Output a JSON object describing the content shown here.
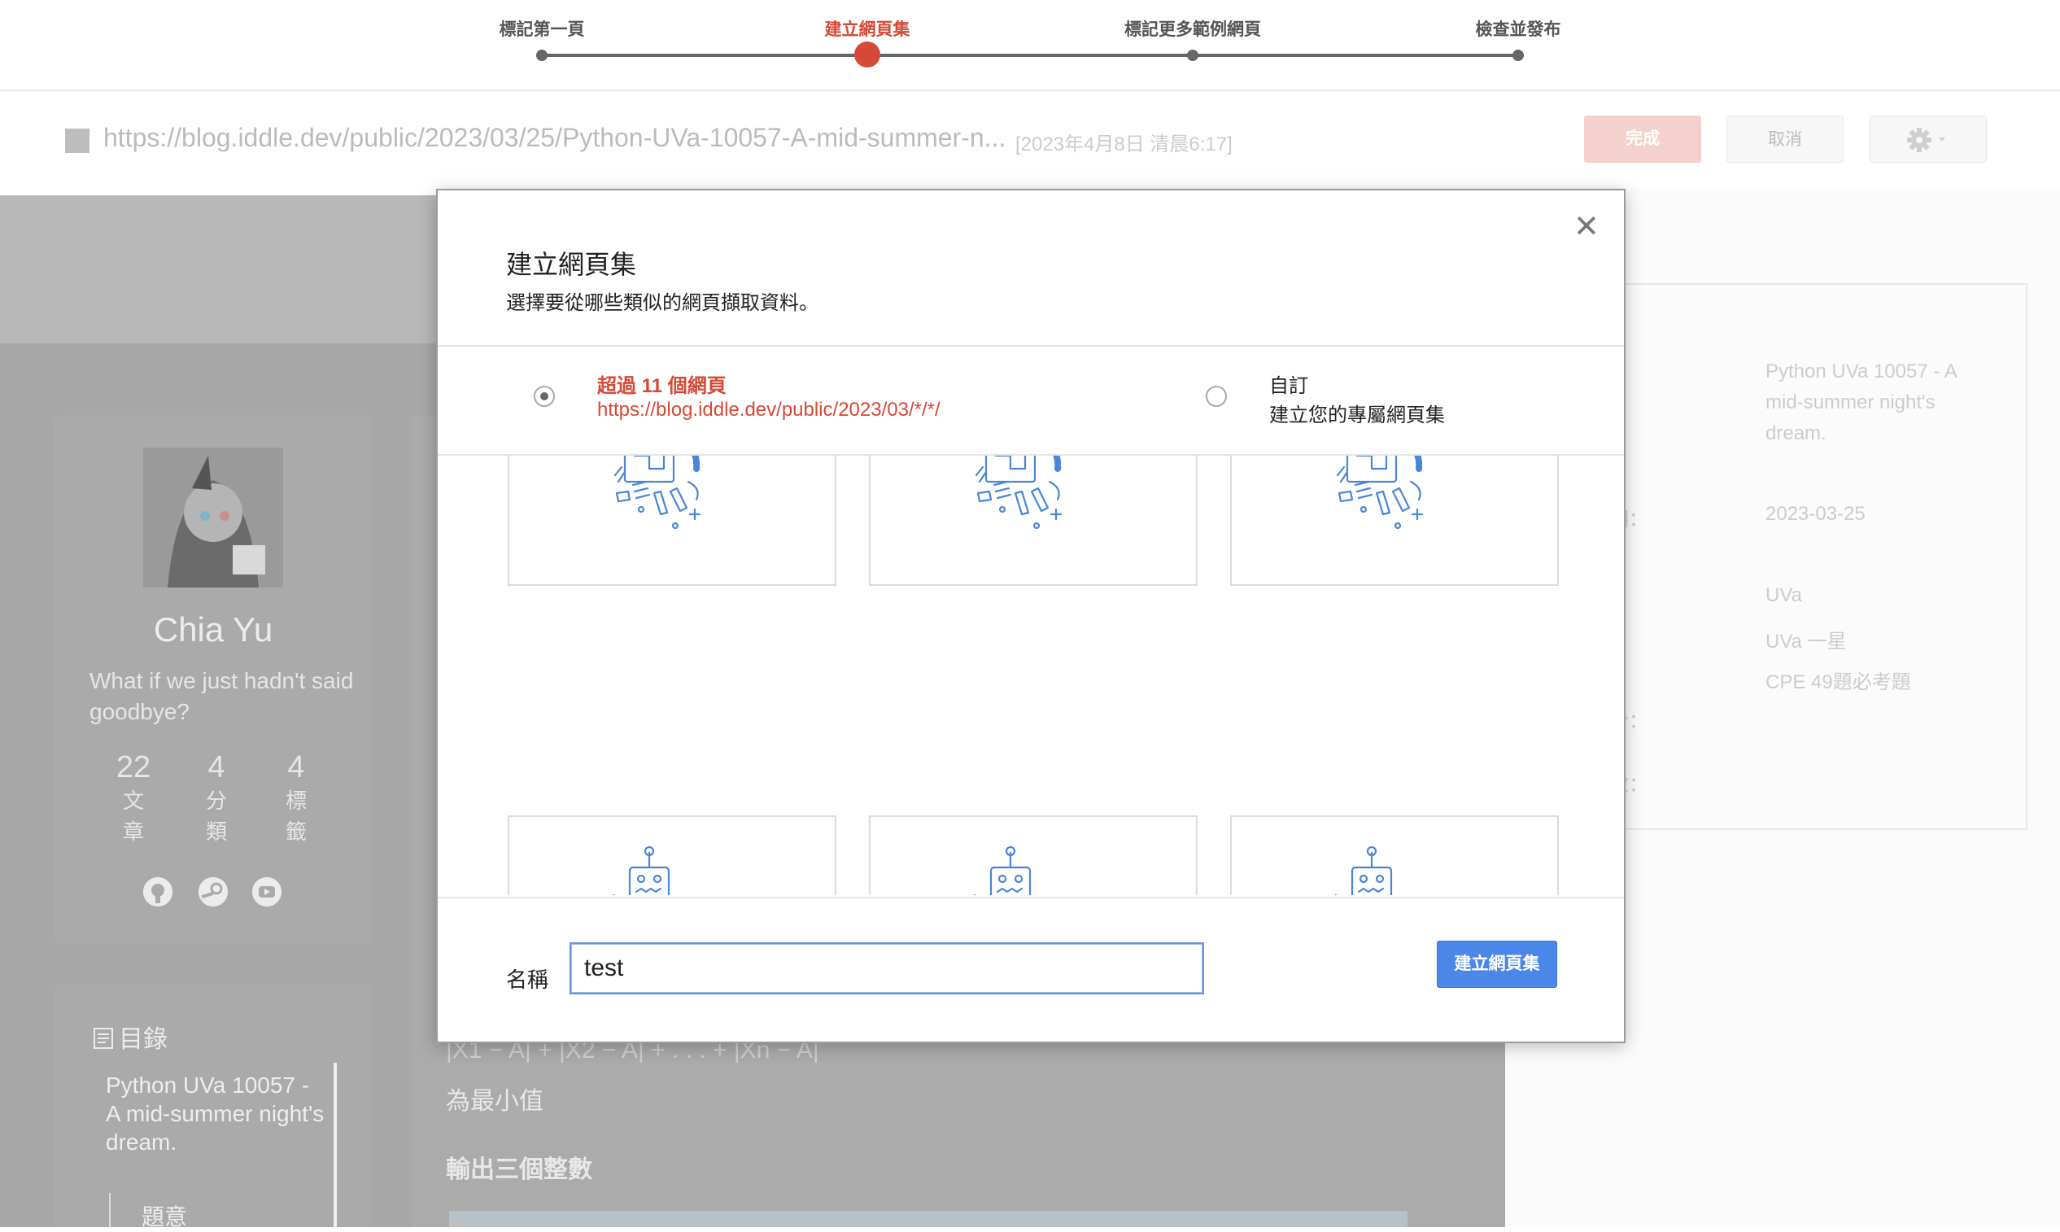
{
  "stepper": {
    "steps": [
      {
        "label": "標記第一頁"
      },
      {
        "label": "建立網頁集"
      },
      {
        "label": "標記更多範例網頁"
      },
      {
        "label": "檢查並發布"
      }
    ],
    "active_step": 2
  },
  "toolbar": {
    "url": "https://blog.iddle.dev/public/2023/03/25/Python-UVa-10057-A-mid-summer-n...",
    "date": "[2023年4月8日 清晨6:17]",
    "done_label": "完成",
    "cancel_label": "取消",
    "settings_icon": "gear-icon"
  },
  "background": {
    "profile": {
      "name": "Chia Yu",
      "motto": "What if we just hadn't said goodbye?",
      "stats": [
        {
          "num": "22",
          "label": "文章"
        },
        {
          "num": "4",
          "label": "分類"
        },
        {
          "num": "4",
          "label": "標籤"
        }
      ],
      "social_icons": [
        "github-icon",
        "steam-icon",
        "youtube-icon"
      ]
    },
    "toc": {
      "title": "目錄",
      "item": "Python UVa 10057 - A mid-summer night's dream.",
      "sub": "題意"
    },
    "content": {
      "formula": "|X1 − A| + |X2 − A| + . . . + |Xn − A|",
      "line": "為最小值",
      "heading": "輸出三個整數"
    },
    "right_panel": {
      "title": "Python UVa 10057 - A mid-summer night's dream.",
      "date_label": "期：",
      "date": "2023-03-25",
      "tags": [
        "UVa",
        "UVa 一星",
        "CPE 49題必考題"
      ],
      "label3": "分：",
      "label4": "數："
    }
  },
  "modal": {
    "title": "建立網頁集",
    "subtitle": "選擇要從哪些類似的網頁擷取資料。",
    "close_icon": "close-icon",
    "option1": {
      "title": "超過 11 個網頁",
      "url": "https://blog.iddle.dev/public/2023/03/*/*/",
      "selected": true
    },
    "option2": {
      "title": "自訂",
      "subtitle": "建立您的專屬網頁集",
      "selected": false
    },
    "tile_icon": "robot-loading-icon",
    "name_label": "名稱",
    "name_value": "test",
    "create_button": "建立網頁集"
  },
  "colors": {
    "accent": "#d54a36",
    "primary_button": "#4a87e8",
    "overlay": "#a7a7a7"
  }
}
